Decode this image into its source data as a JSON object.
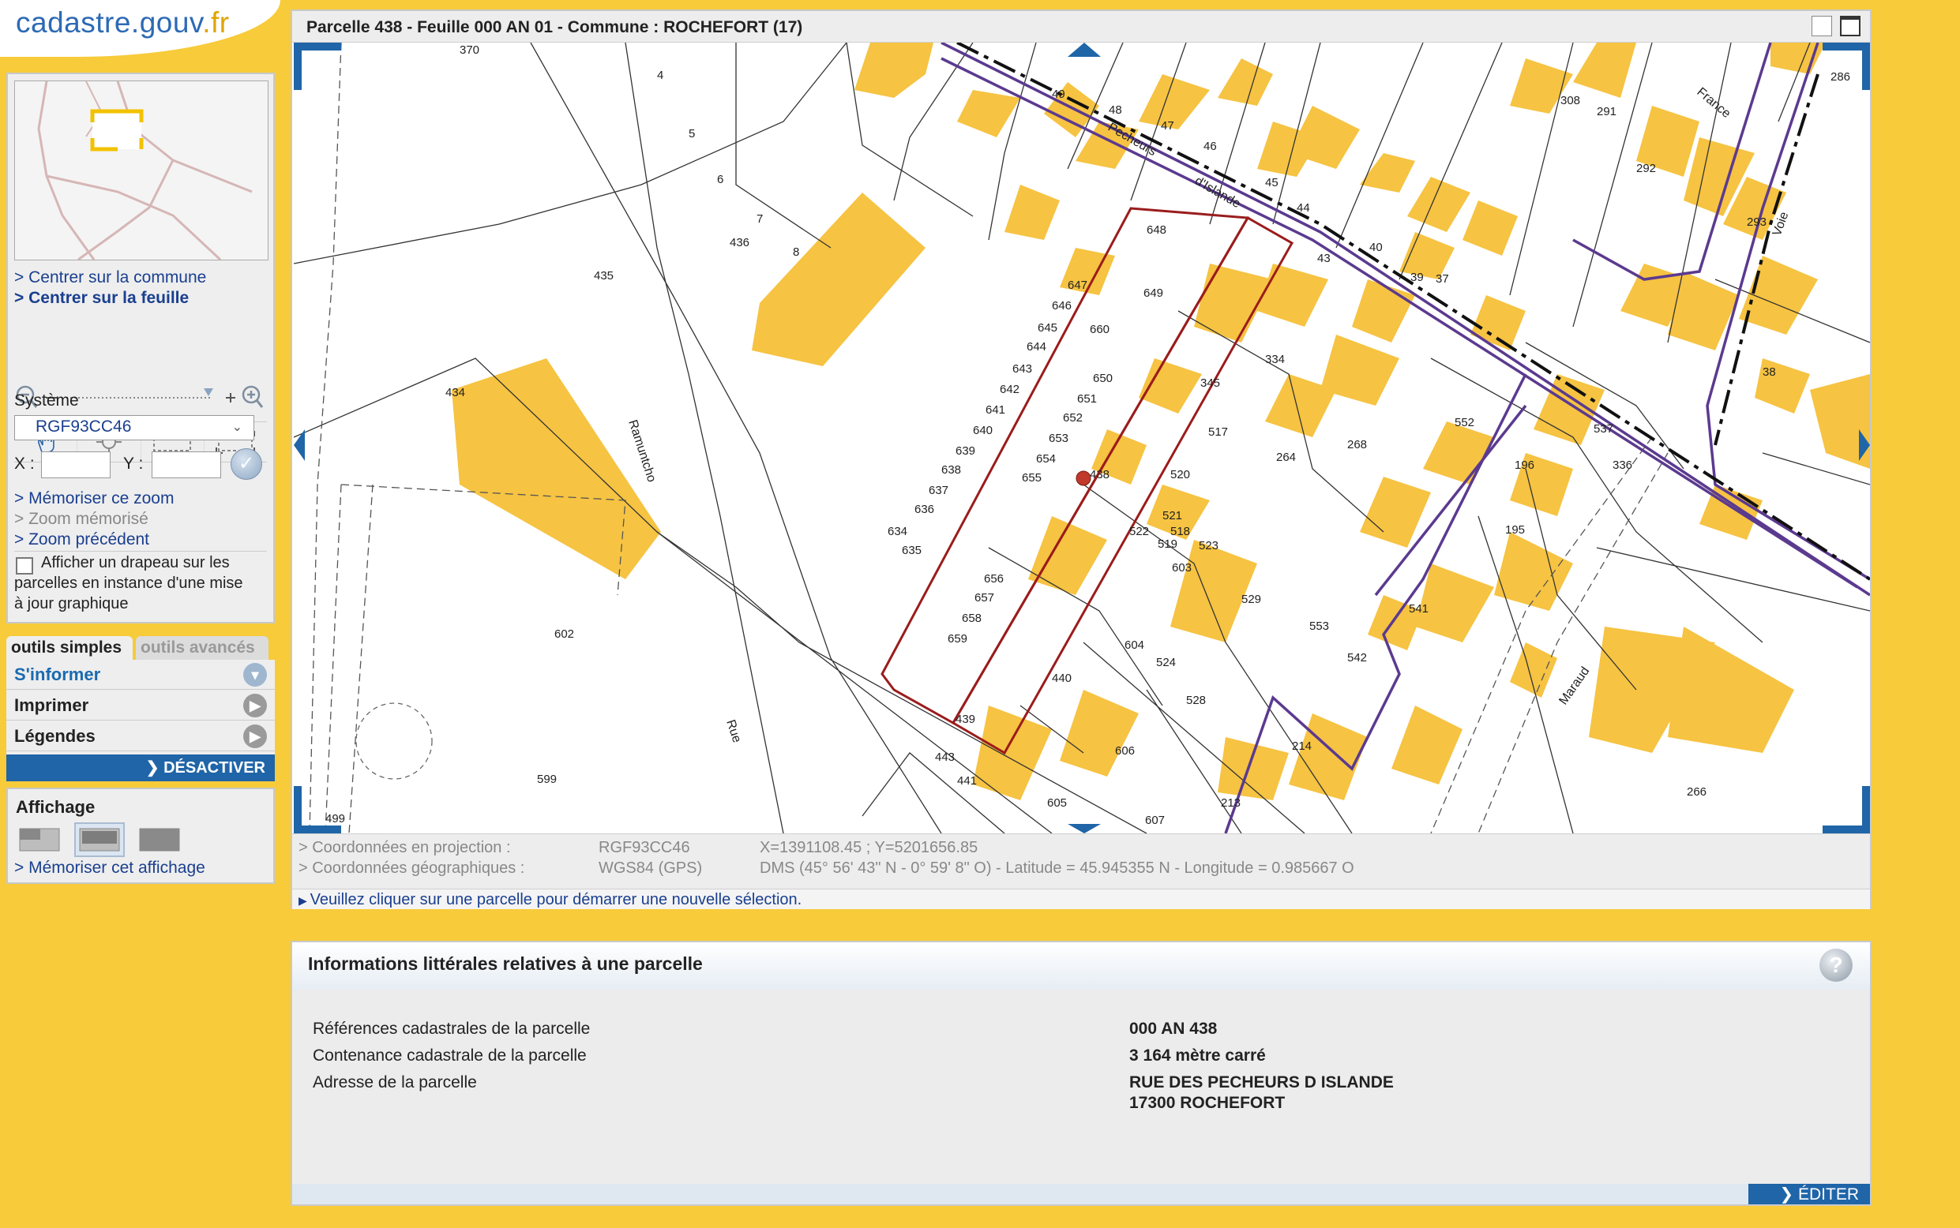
{
  "logo": {
    "text_main": "cadastre.gouv",
    "text_tld": ".fr"
  },
  "colors": {
    "background": "#f7cb3a",
    "building": "#f6c342",
    "selected_parcel": "#9b1c1c",
    "commune_limit": "#5b3a8f",
    "accent_blue": "#1f65a8"
  },
  "left_panel": {
    "links": {
      "center_commune": "> Centrer sur la commune",
      "center_sheet": "> Centrer sur la feuille",
      "save_zoom": "> Mémoriser ce zoom",
      "saved_zoom": "> Zoom mémorisé",
      "previous_zoom": "> Zoom précédent"
    },
    "system_label": "Système",
    "system_value": "RGF93CC46",
    "x_label": "X :",
    "y_label": "Y :",
    "flag_checkbox_label_1": "Afficher un drapeau sur les",
    "flag_checkbox_label_2": "parcelles en instance d'une mise",
    "flag_checkbox_label_3": "à jour graphique",
    "tabs": {
      "simple": "outils simples",
      "advanced": "outils avancés"
    },
    "tools": {
      "inform": "S'informer",
      "print": "Imprimer",
      "legends": "Légendes"
    },
    "deactivate": "DÉSACTIVER",
    "display_title": "Affichage",
    "save_display": "> Mémoriser cet affichage"
  },
  "map_window": {
    "title": "Parcelle 438 - Feuille 000 AN 01 - Commune : ROCHEFORT (17)",
    "projection_label": "> Coordonnées en projection :",
    "projection_system": "RGF93CC46",
    "projection_value": "X=1391108.45 ; Y=5201656.85",
    "geo_label": "> Coordonnées géographiques :",
    "geo_system": "WGS84 (GPS)",
    "geo_value": "DMS (45° 56' 43\" N - 0° 59' 8\" O) - Latitude = 45.945355 N - Longitude = 0.985667 O",
    "status_message": "Veuillez cliquer sur une parcelle pour démarrer une nouvelle sélection.",
    "parcel_numbers": [
      "370",
      "4",
      "5",
      "6",
      "7",
      "8",
      "49",
      "48",
      "47",
      "46",
      "45",
      "44",
      "43",
      "40",
      "39",
      "37",
      "38",
      "308",
      "291",
      "292",
      "293",
      "286",
      "436",
      "435",
      "434",
      "648",
      "649",
      "647",
      "646",
      "645",
      "644",
      "643",
      "642",
      "641",
      "640",
      "639",
      "638",
      "637",
      "636",
      "634",
      "635",
      "650",
      "651",
      "652",
      "653",
      "654",
      "655",
      "660",
      "345",
      "334",
      "517",
      "264",
      "268",
      "552",
      "537",
      "196",
      "336",
      "195",
      "520",
      "521",
      "518",
      "519",
      "522",
      "523",
      "603",
      "529",
      "541",
      "553",
      "542",
      "604",
      "524",
      "528",
      "214",
      "440",
      "438",
      "656",
      "657",
      "658",
      "659",
      "439",
      "443",
      "441",
      "605",
      "606",
      "607",
      "213",
      "602",
      "599",
      "499",
      "266"
    ],
    "street_names": [
      "Ramuntcho",
      "Rue",
      "Pecheurs",
      "d'Islande",
      "France",
      "Maraud",
      "Voie"
    ]
  },
  "info_panel": {
    "title": "Informations littérales relatives à une parcelle",
    "rows": [
      {
        "label": "Références cadastrales de la parcelle",
        "value": "000 AN 438"
      },
      {
        "label": "Contenance cadastrale de la parcelle",
        "value": "3 164 mètre carré"
      },
      {
        "label": "Adresse de la parcelle",
        "value": "RUE DES PECHEURS D ISLANDE",
        "value2": "17300 ROCHEFORT"
      }
    ],
    "edit": "ÉDITER"
  }
}
